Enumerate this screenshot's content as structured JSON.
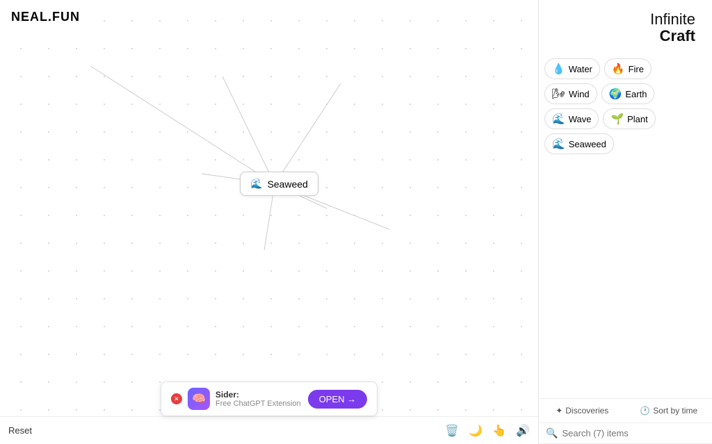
{
  "logo": {
    "text": "NEAL.FUN"
  },
  "title": {
    "line1": "Infinite",
    "line2": "Craft"
  },
  "elements": [
    {
      "id": "water",
      "emoji": "💧",
      "label": "Water",
      "color": "#3b82f6"
    },
    {
      "id": "fire",
      "emoji": "🔥",
      "label": "Fire",
      "color": "#f97316"
    },
    {
      "id": "wind",
      "emoji": "🌬️",
      "label": "Wind",
      "color": "#6b7280"
    },
    {
      "id": "earth",
      "emoji": "🌍",
      "label": "Earth",
      "color": "#22c55e"
    },
    {
      "id": "wave",
      "emoji": "🌊",
      "label": "Wave",
      "color": "#06b6d4"
    },
    {
      "id": "plant",
      "emoji": "🌱",
      "label": "Plant",
      "color": "#84cc16"
    },
    {
      "id": "seaweed",
      "emoji": "🌊",
      "label": "Seaweed",
      "color": "#06b6d4"
    }
  ],
  "canvas_element": {
    "emoji": "🌊",
    "label": "Seaweed"
  },
  "sidebar_tabs": [
    {
      "id": "discoveries",
      "icon": "✦",
      "label": "Discoveries"
    },
    {
      "id": "sort",
      "icon": "🕐",
      "label": "Sort by time"
    }
  ],
  "search": {
    "placeholder": "Search (7) items"
  },
  "bottom": {
    "reset_label": "Reset",
    "icons": [
      "🗑️",
      "🌙",
      "👆",
      "🔊"
    ]
  },
  "ad": {
    "title": "Sider:",
    "subtitle": "Free ChatGPT Extension",
    "open_label": "OPEN →"
  }
}
